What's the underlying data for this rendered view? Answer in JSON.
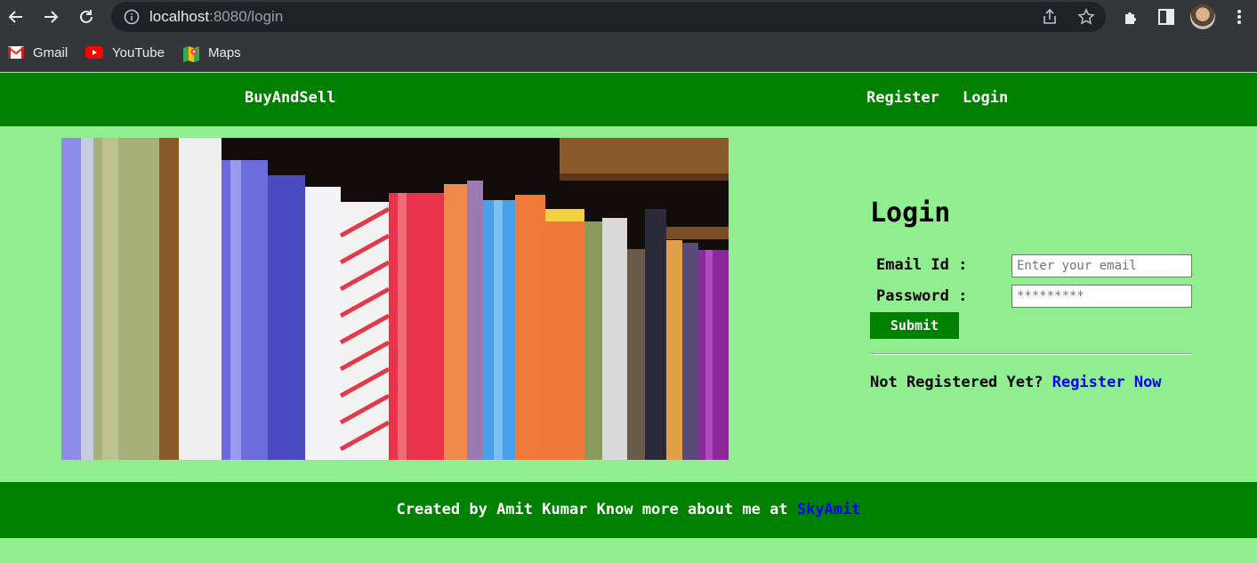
{
  "browser": {
    "url_host": "localhost",
    "url_path": ":8080/login",
    "icons": [
      "back-icon",
      "forward-icon",
      "reload-icon",
      "site-info-icon",
      "share-icon",
      "bookmark-star-icon",
      "extensions-icon",
      "side-panel-icon",
      "avatar",
      "more-menu-icon"
    ],
    "bookmarks": [
      {
        "label": "Gmail",
        "icon": "gmail-icon"
      },
      {
        "label": "YouTube",
        "icon": "youtube-icon"
      },
      {
        "label": "Maps",
        "icon": "maps-icon"
      }
    ]
  },
  "header": {
    "brand": "BuyAndSell",
    "nav": {
      "register": "Register",
      "login": "Login"
    },
    "color": "#008000"
  },
  "login": {
    "title": "Login",
    "email_label": "Email Id :",
    "email_placeholder": "Enter your email",
    "password_label": "Password :",
    "password_placeholder": "*********",
    "submit_label": "Submit",
    "prompt_text": "Not Registered Yet?",
    "register_link": "Register Now"
  },
  "footer": {
    "text": "Created by Amit Kumar Know more about me at",
    "link": "SkyAmit"
  },
  "colors": {
    "page_bg": "#90ee90",
    "accent": "#008000",
    "link": "#0000ff"
  }
}
